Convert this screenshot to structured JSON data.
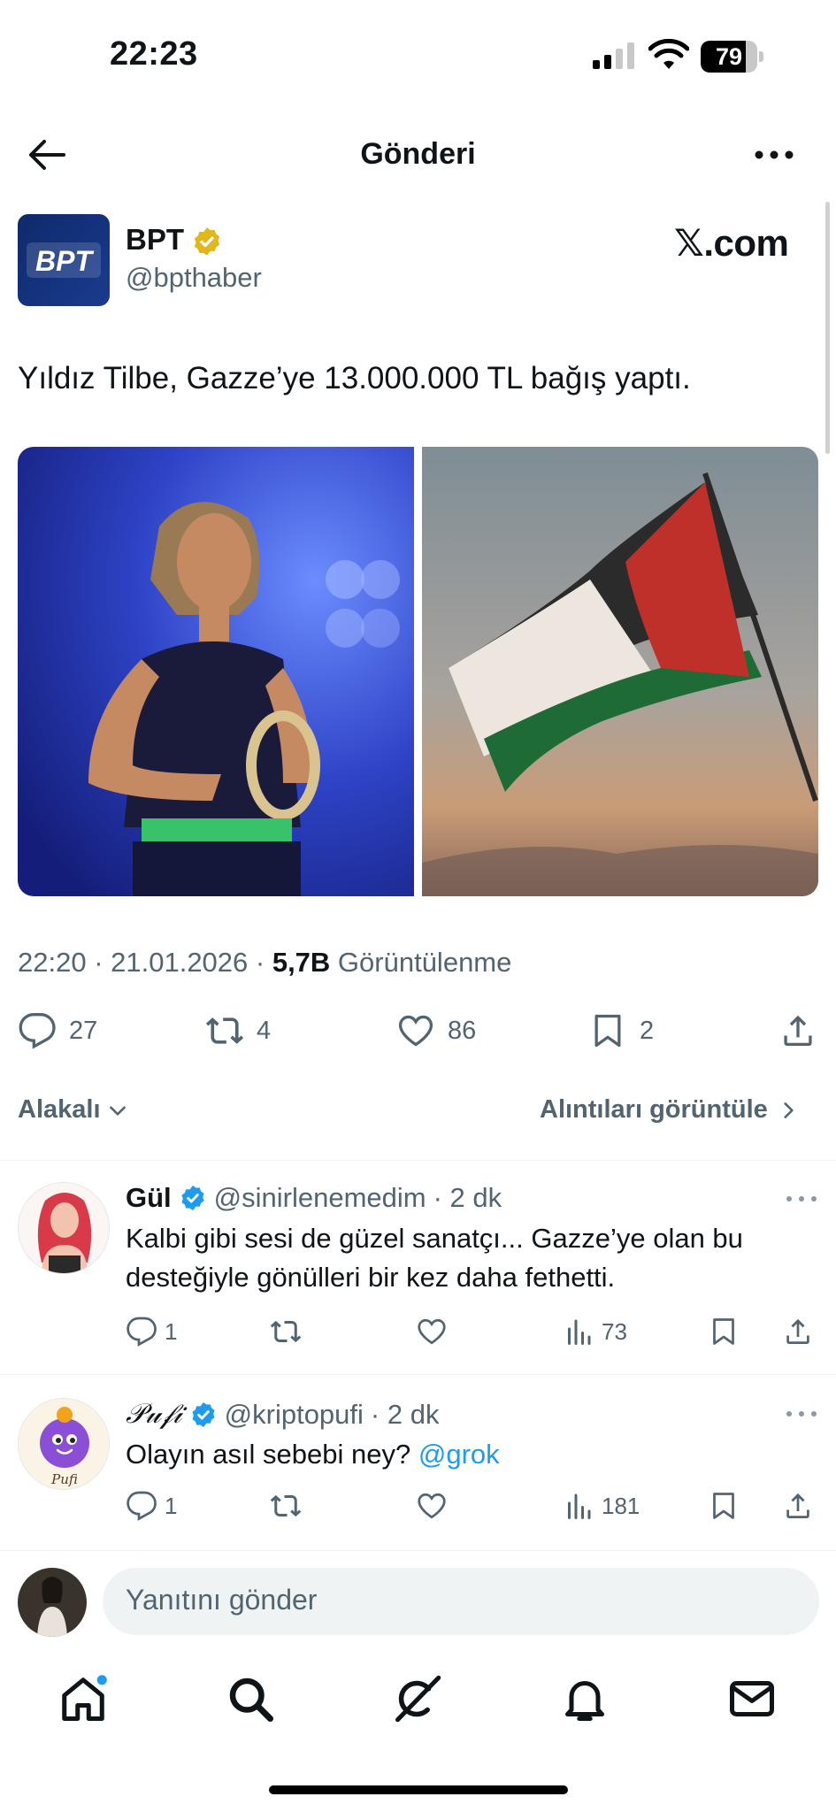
{
  "status_bar": {
    "time": "22:23",
    "battery": "79",
    "battery_level": 0.79
  },
  "header": {
    "title": "Gönderi"
  },
  "post": {
    "author_name": "BPT",
    "author_handle": "@bpthaber",
    "avatar_text": "BPT",
    "watermark": "𝕏.com",
    "text": "Yıldız Tilbe, Gazze’ye 13.000.000 TL bağış yaptı.",
    "meta_time": "22:20 · 21.01.2026 · ",
    "meta_views": "5,7B",
    "meta_views_label": " Görüntülenme",
    "actions": {
      "replies": "27",
      "reposts": "4",
      "likes": "86",
      "bookmarks": "2"
    }
  },
  "sort": {
    "label": "Alakalı",
    "quotes_label": "Alıntıları görüntüle"
  },
  "replies": [
    {
      "name": "Gül",
      "handle": "@sinirlenemedim",
      "time": "· 2 dk",
      "text": "Kalbi gibi sesi de güzel sanatçı... Gazze’ye olan bu desteğiyle gönülleri bir kez daha fethetti.",
      "replies": "1",
      "views": "73"
    },
    {
      "name": "𝒫𝓊𝒻𝒾",
      "handle": "@kriptopufi",
      "time": "· 2 dk",
      "text_prefix": "Olayın asıl sebebi ney? ",
      "mention": "@grok",
      "avatar_label": "Pufi",
      "replies": "1",
      "views": "181"
    }
  ],
  "composer": {
    "placeholder": "Yanıtını gönder"
  },
  "colors": {
    "accent": "#1d9bf0",
    "muted": "#536471",
    "verified_gold": "#e2b719"
  }
}
